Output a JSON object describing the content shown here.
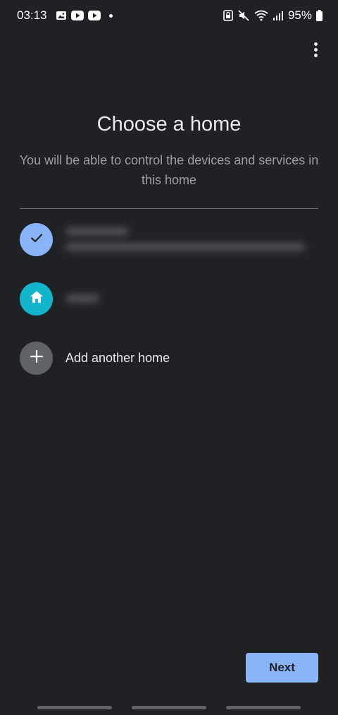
{
  "status_bar": {
    "time": "03:13",
    "battery": "95%",
    "left_icons": [
      "gallery-icon",
      "youtube-icon",
      "youtube-icon"
    ],
    "right_icons": [
      "lock-icon",
      "mute-icon",
      "wifi-icon",
      "signal-icon",
      "battery-icon"
    ]
  },
  "header": {
    "title": "Choose a home",
    "subtitle": "You will be able to control the devices and services in this home"
  },
  "homes": [
    {
      "icon": "check-icon",
      "selected": true,
      "name": "",
      "address": ""
    },
    {
      "icon": "home-icon",
      "selected": false,
      "name": ""
    }
  ],
  "add_home": {
    "icon": "plus-icon",
    "label": "Add another home"
  },
  "footer": {
    "next_label": "Next"
  },
  "colors": {
    "background": "#202124",
    "accent": "#8ab4f8",
    "teal": "#12b5cb",
    "grey": "#5f6368",
    "text_primary": "#e8eaed",
    "text_secondary": "#9aa0a6"
  }
}
